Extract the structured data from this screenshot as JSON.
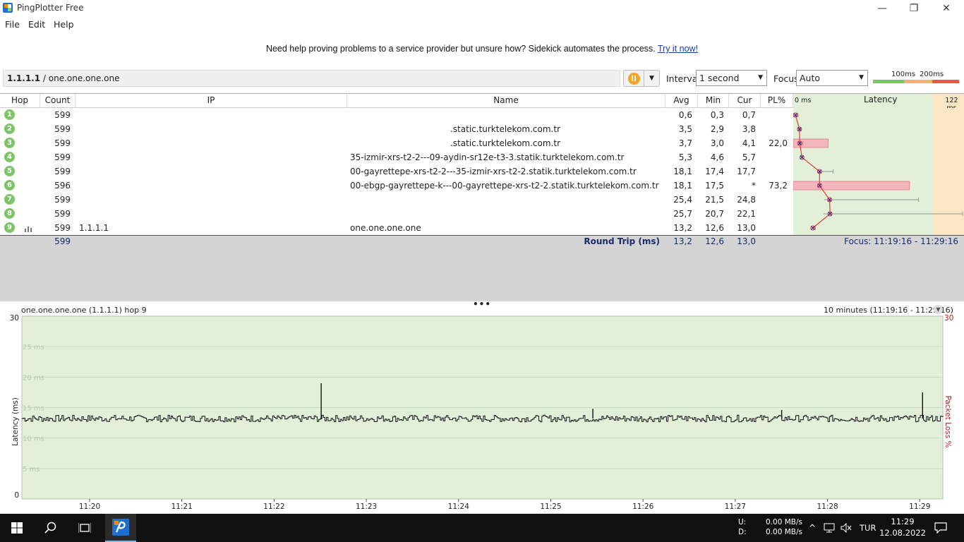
{
  "window": {
    "title": "PingPlotter Free",
    "minimize": "—",
    "restore": "❐",
    "close": "✕"
  },
  "menu": [
    "File",
    "Edit",
    "Help"
  ],
  "banner": {
    "text": "Need help proving problems to a service provider but unsure how? Sidekick automates the process.",
    "link": "Try it now!"
  },
  "toolbar": {
    "target_ip": "1.1.1.1",
    "target_sep": " / ",
    "target_name": "one.one.one.one",
    "interval_label": "Interval",
    "interval_value": "1 second",
    "focus_label": "Focus",
    "focus_value": "Auto",
    "scale_100": "100ms",
    "scale_200": "200ms"
  },
  "table": {
    "headers": {
      "hop": "Hop",
      "count": "Count",
      "ip": "IP",
      "name": "Name",
      "avg": "Avg",
      "min": "Min",
      "cur": "Cur",
      "pl": "PL%",
      "zero": "0 ms",
      "latency": "Latency",
      "max": "122 ms"
    },
    "rows": [
      {
        "hop": "1",
        "count": "599",
        "ip": "",
        "name": "",
        "avg": "0,6",
        "min": "0,3",
        "cur": "0,7",
        "pl": "",
        "avg_ms": 0.6,
        "min_ms": 0.3,
        "max_ms": 2.5,
        "pl_val": 0
      },
      {
        "hop": "2",
        "count": "599",
        "ip": "",
        "name": ".static.turktelekom.com.tr",
        "avg": "3,5",
        "min": "2,9",
        "cur": "3,8",
        "pl": "",
        "avg_ms": 3.5,
        "min_ms": 2.9,
        "max_ms": 4.5,
        "pl_val": 0
      },
      {
        "hop": "3",
        "count": "599",
        "ip": "",
        "name": ".static.turktelekom.com.tr",
        "avg": "3,7",
        "min": "3,0",
        "cur": "4,1",
        "pl": "22,0",
        "avg_ms": 3.7,
        "min_ms": 3.0,
        "max_ms": 6.0,
        "pl_val": 22.0
      },
      {
        "hop": "4",
        "count": "599",
        "ip": "",
        "name": "35-izmir-xrs-t2-2---09-aydin-sr12e-t3-3.statik.turktelekom.com.tr",
        "avg": "5,3",
        "min": "4,6",
        "cur": "5,7",
        "pl": "",
        "avg_ms": 5.3,
        "min_ms": 4.6,
        "max_ms": 6.0,
        "pl_val": 0
      },
      {
        "hop": "5",
        "count": "599",
        "ip": "",
        "name": "00-gayrettepe-xrs-t2-2---35-izmir-xrs-t2-2.statik.turktelekom.com.tr",
        "avg": "18,1",
        "min": "17,4",
        "cur": "17,7",
        "pl": "",
        "avg_ms": 18.1,
        "min_ms": 17.4,
        "max_ms": 28.0,
        "pl_val": 0
      },
      {
        "hop": "6",
        "count": "596",
        "ip": "",
        "name": "00-ebgp-gayrettepe-k---00-gayrettepe-xrs-t2-2.statik.turktelekom.com.tr",
        "avg": "18,1",
        "min": "17,5",
        "cur": "*",
        "pl": "73,2",
        "avg_ms": 18.1,
        "min_ms": 17.5,
        "max_ms": 18.5,
        "pl_val": 73.2
      },
      {
        "hop": "7",
        "count": "599",
        "ip": "",
        "name": "",
        "avg": "25,4",
        "min": "21,5",
        "cur": "24,8",
        "pl": "",
        "avg_ms": 25.4,
        "min_ms": 21.5,
        "max_ms": 90.0,
        "pl_val": 0
      },
      {
        "hop": "8",
        "count": "599",
        "ip": "",
        "name": "",
        "avg": "25,7",
        "min": "20,7",
        "cur": "22,1",
        "pl": "",
        "avg_ms": 25.7,
        "min_ms": 20.7,
        "max_ms": 122.0,
        "pl_val": 0
      },
      {
        "hop": "9",
        "count": "599",
        "ip": "1.1.1.1",
        "name": "one.one.one.one",
        "avg": "13,2",
        "min": "12,6",
        "cur": "13,0",
        "pl": "",
        "avg_ms": 13.2,
        "min_ms": 12.6,
        "max_ms": 15.0,
        "pl_val": 0
      }
    ],
    "summary": {
      "count": "599",
      "label": "Round Trip (ms)",
      "avg": "13,2",
      "min": "12,6",
      "cur": "13,0",
      "focus": "Focus: 11:19:16 - 11:29:16"
    }
  },
  "graph": {
    "title": "one.one.one.one (1.1.1.1) hop 9",
    "range": "10 minutes (11:19:16 - 11:29:16)",
    "ylabel": "Latency (ms)",
    "y2label": "Packet Loss %",
    "ymax": "30",
    "ymin": "0",
    "y2max": "30",
    "gridlabels": [
      "25 ms",
      "20 ms",
      "15 ms",
      "10 ms",
      "5 ms"
    ],
    "xticks": [
      "11:20",
      "11:21",
      "11:22",
      "11:23",
      "11:24",
      "11:25",
      "11:26",
      "11:27",
      "11:28",
      "11:29"
    ],
    "baseline_ms": 13.2,
    "spikes": [
      {
        "pos": 0.325,
        "ms": 19.0
      },
      {
        "pos": 0.978,
        "ms": 17.5
      },
      {
        "pos": 0.62,
        "ms": 14.8
      },
      {
        "pos": 0.825,
        "ms": 14.6
      }
    ]
  },
  "taskbar": {
    "up": "U:",
    "down": "D:",
    "up_rate": "0.00 MB/s",
    "down_rate": "0.00 MB/s",
    "lang": "TUR",
    "time": "11:29",
    "date": "12.08.2022"
  },
  "colors": {
    "green_bg": "#e2f0d9",
    "orange_bg": "#fde6c6",
    "red_bar": "#f4b6bd",
    "hop_green": "#7cc36a",
    "accent_link": "#1a3ea8"
  }
}
